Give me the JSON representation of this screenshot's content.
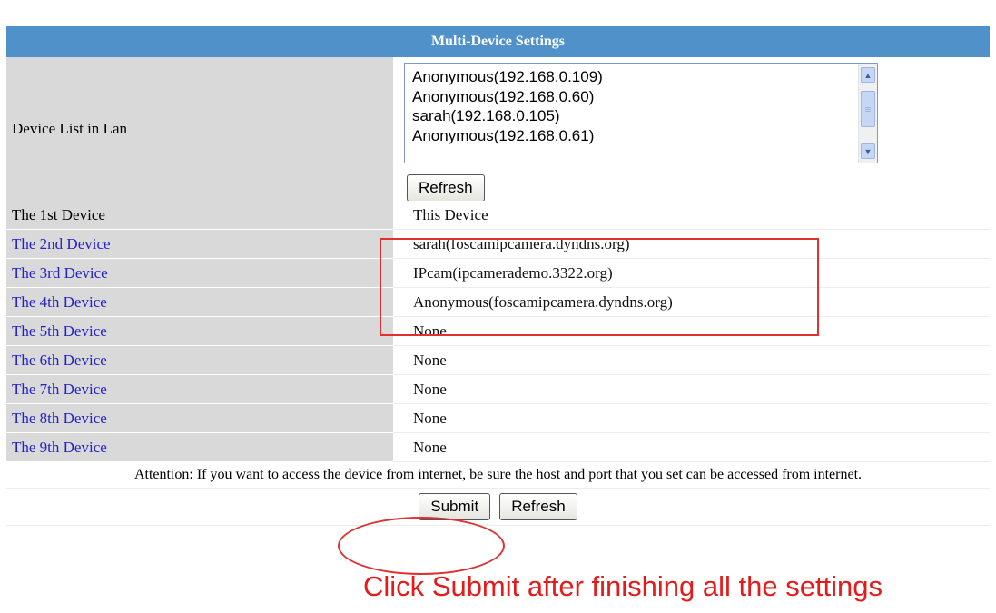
{
  "title": "Multi-Device Settings",
  "device_list": {
    "label": "Device List in Lan",
    "items": [
      "Anonymous(192.168.0.109)",
      "Anonymous(192.168.0.60)",
      "sarah(192.168.0.105)",
      "Anonymous(192.168.0.61)"
    ],
    "refresh_label": "Refresh"
  },
  "devices": [
    {
      "label": "The 1st Device",
      "value": "This Device"
    },
    {
      "label": "The 2nd Device",
      "value": "sarah(foscamipcamera.dyndns.org)"
    },
    {
      "label": "The 3rd Device",
      "value": "IPcam(ipcamerademo.3322.org)"
    },
    {
      "label": "The 4th Device",
      "value": "Anonymous(foscamipcamera.dyndns.org)"
    },
    {
      "label": "The 5th Device",
      "value": "None"
    },
    {
      "label": "The 6th Device",
      "value": "None"
    },
    {
      "label": "The 7th Device",
      "value": "None"
    },
    {
      "label": "The 8th Device",
      "value": "None"
    },
    {
      "label": "The 9th Device",
      "value": "None"
    }
  ],
  "attention": "Attention: If you want to access the device from internet, be sure the host and port that you set can be accessed from internet.",
  "buttons": {
    "submit": "Submit",
    "refresh": "Refresh"
  },
  "annotation": "Click Submit after finishing all the settings",
  "colors": {
    "title_bar": "#4f91c8",
    "label_bg": "#d9d9d9",
    "link": "#2323c8",
    "annotation": "#e31b1b"
  }
}
